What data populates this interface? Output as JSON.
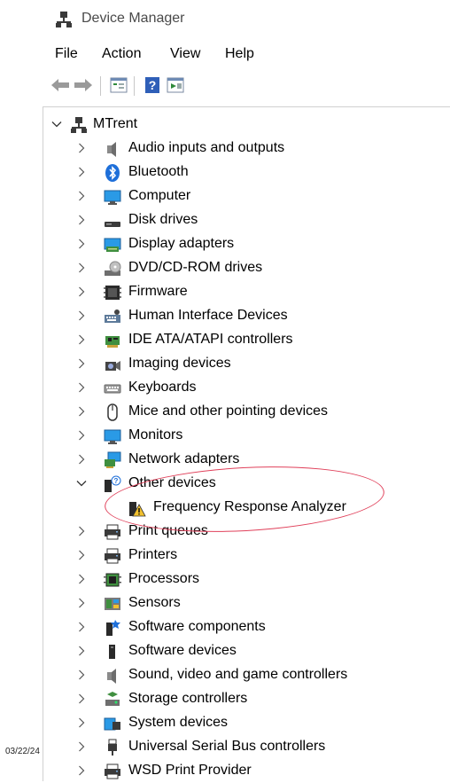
{
  "window": {
    "title": "Device Manager",
    "title_icon": "device-manager-icon"
  },
  "menu": {
    "items": [
      "File",
      "Action",
      "View",
      "Help"
    ]
  },
  "toolbar": {
    "buttons": [
      "back-arrow-icon",
      "forward-arrow-icon",
      "properties-icon",
      "help-icon",
      "scan-hardware-icon"
    ]
  },
  "tree": {
    "root": {
      "label": "MTrent",
      "icon": "computer-tower-icon",
      "expanded": true
    },
    "categories": [
      {
        "label": "Audio inputs and outputs",
        "icon": "speaker-icon"
      },
      {
        "label": "Bluetooth",
        "icon": "bluetooth-icon"
      },
      {
        "label": "Computer",
        "icon": "monitor-icon"
      },
      {
        "label": "Disk drives",
        "icon": "disk-drive-icon"
      },
      {
        "label": "Display adapters",
        "icon": "display-adapter-icon"
      },
      {
        "label": "DVD/CD-ROM drives",
        "icon": "dvd-drive-icon"
      },
      {
        "label": "Firmware",
        "icon": "firmware-icon"
      },
      {
        "label": "Human Interface Devices",
        "icon": "hid-icon"
      },
      {
        "label": "IDE ATA/ATAPI controllers",
        "icon": "ide-controller-icon"
      },
      {
        "label": "Imaging devices",
        "icon": "camera-icon"
      },
      {
        "label": "Keyboards",
        "icon": "keyboard-icon"
      },
      {
        "label": "Mice and other pointing devices",
        "icon": "mouse-icon"
      },
      {
        "label": "Monitors",
        "icon": "monitor-icon"
      },
      {
        "label": "Network adapters",
        "icon": "network-adapter-icon"
      },
      {
        "label": "Other devices",
        "icon": "unknown-device-icon",
        "expanded": true,
        "children": [
          {
            "label": "Frequency Response Analyzer",
            "icon": "warning-device-icon"
          }
        ]
      },
      {
        "label": "Print queues",
        "icon": "printer-icon"
      },
      {
        "label": "Printers",
        "icon": "printer-icon"
      },
      {
        "label": "Processors",
        "icon": "processor-icon"
      },
      {
        "label": "Sensors",
        "icon": "sensor-icon"
      },
      {
        "label": "Software components",
        "icon": "software-component-icon"
      },
      {
        "label": "Software devices",
        "icon": "software-device-icon"
      },
      {
        "label": "Sound, video and game controllers",
        "icon": "speaker-icon"
      },
      {
        "label": "Storage controllers",
        "icon": "storage-controller-icon"
      },
      {
        "label": "System devices",
        "icon": "system-devices-icon"
      },
      {
        "label": "Universal Serial Bus controllers",
        "icon": "usb-icon"
      },
      {
        "label": "WSD Print Provider",
        "icon": "printer-icon"
      }
    ]
  },
  "annotation": {
    "date_stamp": "03/22/24",
    "highlight_color": "#e0405a"
  }
}
